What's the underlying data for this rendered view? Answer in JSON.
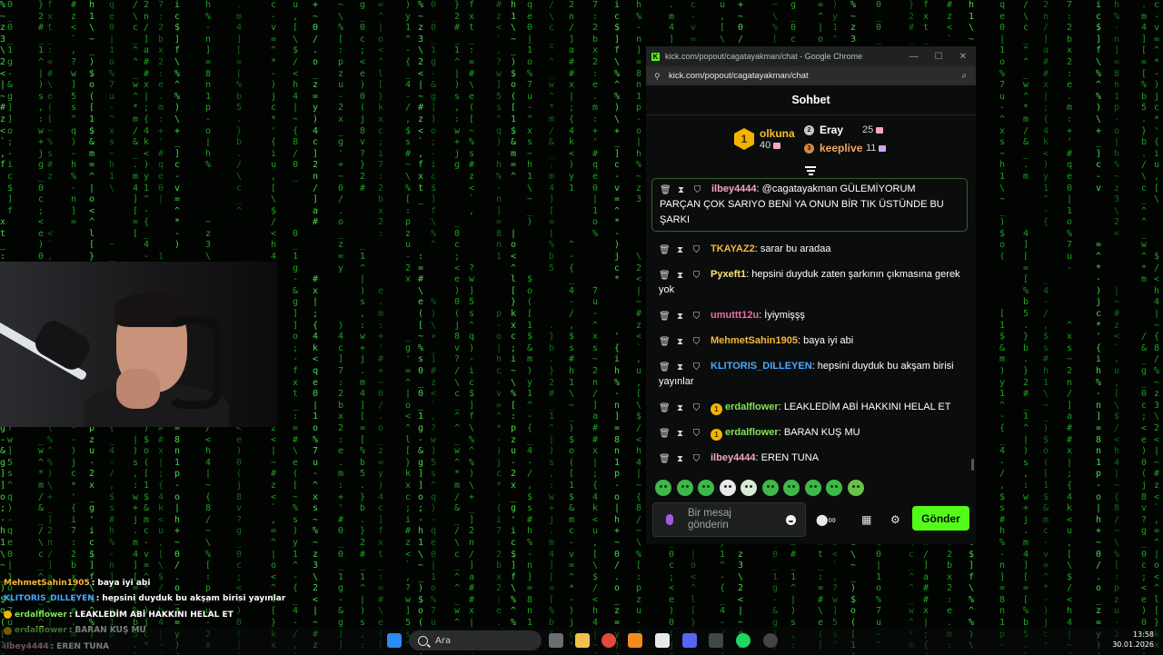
{
  "browser": {
    "title": "kick.com/popout/cagatayakman/chat - Google Chrome",
    "url": "kick.com/popout/cagatayakman/chat"
  },
  "chat": {
    "header": "Sohbet",
    "leaderboard": {
      "first": {
        "name": "olkuna",
        "count": "40",
        "rank": "1"
      },
      "second": {
        "name": "Eray",
        "count": "25"
      },
      "third": {
        "name": "keeplive",
        "count": "11"
      }
    },
    "messages": [
      {
        "user": "ilbey4444",
        "color": "#f2a7c3",
        "text": "@cagatayakman GÜLEMİYORUM PARÇAN ÇOK SARIYO BENİ YA ONUN BİR TIK ÜSTÜNDE BU ŞARKI",
        "pinned": true,
        "badge": ""
      },
      {
        "user": "TKAYAZ2",
        "color": "#f6b73c",
        "text": "sarar bu aradaa",
        "badge": ""
      },
      {
        "user": "Pyxeft1",
        "color": "#fbe27a",
        "text": "hepsini duyduk zaten şarkının çıkmasına gerek yok",
        "badge": ""
      },
      {
        "user": "umuttt12u",
        "color": "#ee6aa6",
        "text": "İyiymişşş",
        "badge": ""
      },
      {
        "user": "MehmetSahin1905",
        "color": "#f6b73c",
        "text": "baya iyi abi",
        "badge": ""
      },
      {
        "user": "KLITORIS_DILLEYEN",
        "color": "#4aa8ff",
        "text": "hepsini duyduk bu akşam birisi yayınlar",
        "badge": ""
      },
      {
        "user": "erdalflower",
        "color": "#82e35a",
        "text": "LEAKLEDİM ABİ HAKKINI HELAL ET",
        "badge": "1"
      },
      {
        "user": "erdalflower",
        "color": "#82e35a",
        "text": "BARAN KUŞ MU",
        "badge": "1"
      },
      {
        "user": "ilbey4444",
        "color": "#f2a7c3",
        "text": "EREN TUNA",
        "badge": ""
      }
    ],
    "composer_placeholder": "Bir mesaj gönderin",
    "send_label": "Gönder"
  },
  "overlay_chat": [
    {
      "user": "MehmetSahin1905",
      "color": "#f6b73c",
      "text": "baya iyi abi",
      "badge": false
    },
    {
      "user": "KLITORIS_DILLEYEN",
      "color": "#4aa8ff",
      "text": "hepsini duyduk bu akşam birisi yayınlar",
      "badge": false
    },
    {
      "user": "erdalflower",
      "color": "#82e35a",
      "text": "LEAKLEDİM ABİ HAKKINI HELAL ET",
      "badge": true
    },
    {
      "user": "erdalflower",
      "color": "#82e35a",
      "text": "BARAN KUŞ MU",
      "badge": true
    },
    {
      "user": "ilbey4444",
      "color": "#f2a7c3",
      "text": "EREN TUNA",
      "badge": false
    }
  ],
  "taskbar": {
    "search_placeholder": "Ara",
    "time": "13:58",
    "date": "30.01.2026"
  },
  "colors": {
    "kick_green": "#53fc18",
    "matrix_green": "#1ca31c"
  },
  "matrix_columns": [
    "%~z3\\2<|~#z<`,",
    "0_0_1g-&g]]o;-",
    "}2#_1^|)s,:w+j",
    "fxt_:=#\\e([~%s",
    "#z<`,?w]5s^q)-",
    "h1\\~_)$o([1$&m",
    "qe0|1o%7u-^xs~",
    "/\\c_^^_w^*m/&_",
    "2n/]a##x|;{4k<",
    "7:2bx2:e.m:+'#",
    "ic$]f\\%^%)\\+_]",
    "h%-n]=8n1p-o|h",
    ".m4][=[%b5.}b.",
    "c-v=^*-)jc*'{i",
    "u,[\\$/<h4|~{8/",
    "+~0/.o_z=y)4c]",
    "~\\%[:pzu-2x_g'",
    "g_0c;<e)0(j8v?",
    "=^|o<^l[}kxc;i",
    ")y1^-{_4-/,$s#"
  ]
}
